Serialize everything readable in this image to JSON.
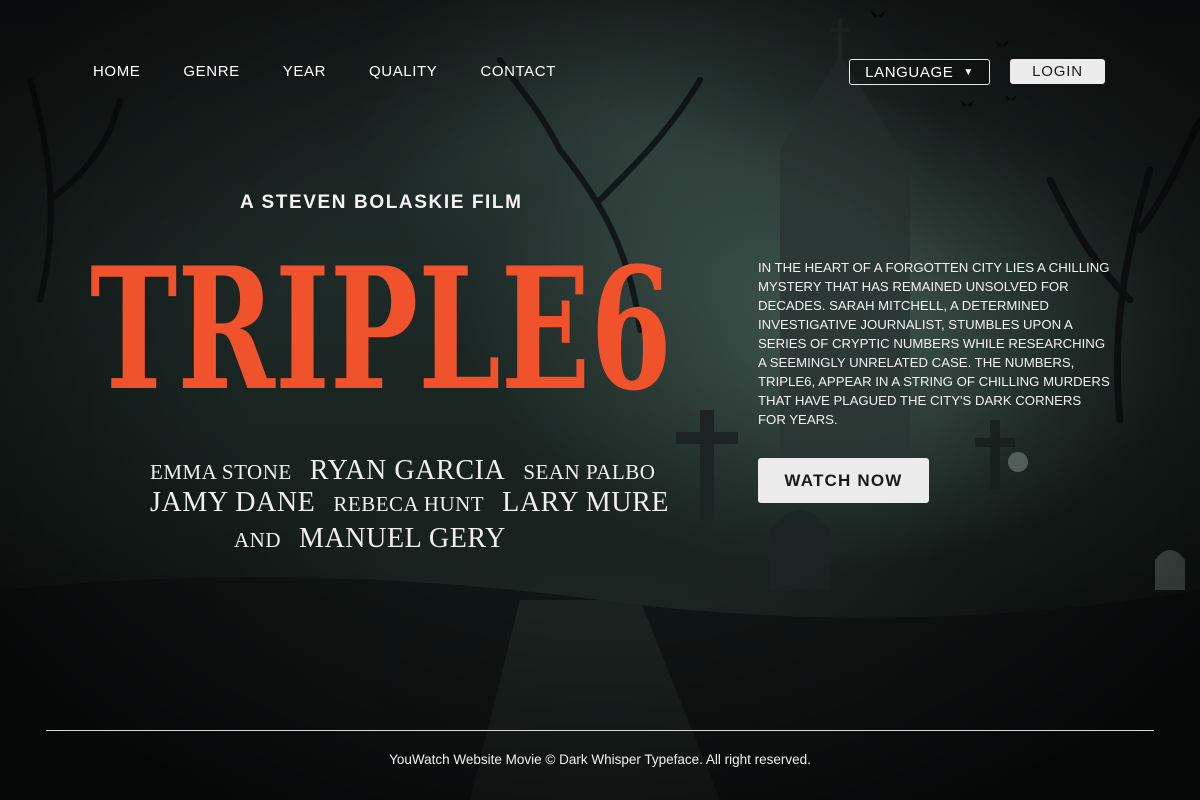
{
  "nav": {
    "items": [
      {
        "label": "HOME"
      },
      {
        "label": "GENRE"
      },
      {
        "label": "YEAR"
      },
      {
        "label": "QUALITY"
      },
      {
        "label": "CONTACT"
      }
    ],
    "language_label": "LANGUAGE",
    "login_label": "LOGIN"
  },
  "hero": {
    "tagline": "A STEVEN BOLASKIE FILM",
    "title": "TRIPLE6",
    "cast": {
      "line1": [
        "EMMA STONE",
        "RYAN GARCIA",
        "SEAN PALBO"
      ],
      "line2": [
        "JAMY DANE",
        "REBECA HUNT",
        "LARY MURE"
      ],
      "line3": [
        "AND",
        "MANUEL GERY"
      ]
    },
    "synopsis": "IN THE HEART OF A FORGOTTEN CITY LIES A CHILLING MYSTERY THAT HAS REMAINED UNSOLVED FOR DECADES. SARAH MITCHELL, A DETERMINED INVESTIGATIVE JOURNALIST, STUMBLES UPON A SERIES OF CRYPTIC NUMBERS WHILE RESEARCHING A SEEMINGLY UNRELATED CASE. THE NUMBERS, TRIPLE6, APPEAR IN A STRING OF CHILLING MURDERS THAT HAVE PLAGUED THE CITY'S DARK CORNERS FOR YEARS.",
    "cta_label": "WATCH NOW"
  },
  "footer": {
    "text": "YouWatch Website Movie © Dark Whisper Typeface. All right reserved."
  },
  "colors": {
    "title_accent": "#f0532c",
    "button_bg": "#ececec",
    "background": "#1a2321"
  },
  "icons": {
    "language_caret": "caret-down-icon"
  }
}
